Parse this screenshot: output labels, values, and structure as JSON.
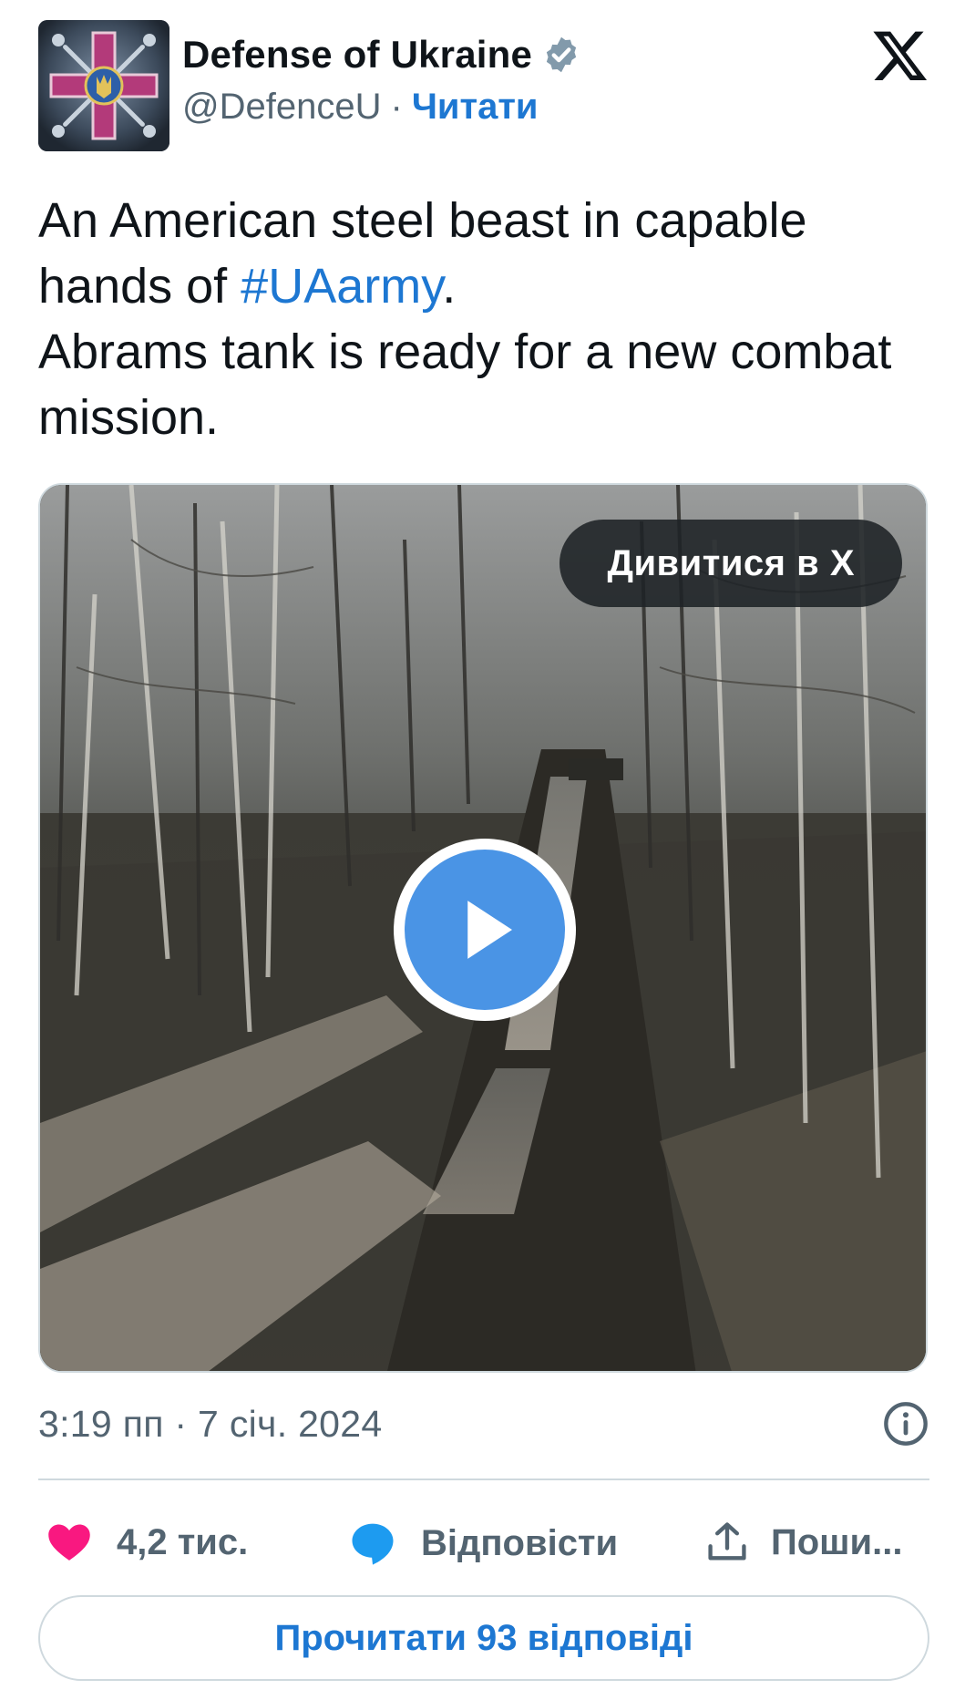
{
  "author": {
    "display_name": "Defense of Ukraine",
    "handle": "@DefenceU",
    "separator": "·",
    "follow_label": "Читати",
    "verified_icon": "verified-badge-icon",
    "verified_color": "#829aab"
  },
  "brand_icon": "x-logo-icon",
  "tweet": {
    "text_line1": "An American steel beast in capable hands of ",
    "hashtag": "#UAarmy",
    "text_after_hashtag": ".",
    "text_line3": "Abrams tank is ready for a new combat mission."
  },
  "media": {
    "watch_label": "Дивитися в X",
    "play_icon": "play-icon"
  },
  "meta": {
    "timestamp": "3:19 пп · 7 січ. 2024",
    "info_icon": "info-icon"
  },
  "actions": {
    "like_count": "4,2 тис.",
    "reply_label": "Відповісти",
    "share_label": "Поши..."
  },
  "read_replies_label": "Прочитати 93 відповіді",
  "colors": {
    "link": "#1d77d2",
    "secondary_text": "#536471",
    "like": "#f91880",
    "reply_bubble": "#1d9bf0",
    "border": "#cfd9de"
  }
}
